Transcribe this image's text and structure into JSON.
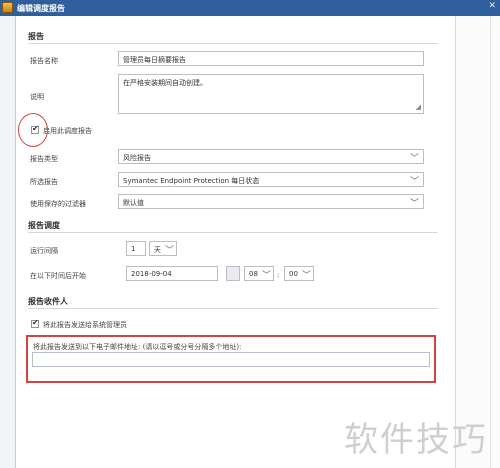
{
  "title": "编辑调度报告",
  "sections": {
    "report": "报告",
    "schedule": "报告调度",
    "recipients": "报告收件人"
  },
  "report": {
    "name_label": "报告名称",
    "name_value": "管理员每日摘要报告",
    "desc_label": "说明",
    "desc_value": "在严格安装期间自动创建。",
    "enable_label": "启用此调度报告",
    "enable_checked": true,
    "type_label": "报告类型",
    "type_value": "风险报告",
    "selected_label": "所选报告",
    "selected_value": "Symantec Endpoint Protection 每日状态",
    "filter_label": "使用保存的过滤器",
    "filter_value": "默认值"
  },
  "schedule": {
    "interval_label": "运行间隔",
    "interval_value": "1",
    "interval_unit": "天",
    "start_label": "在以下时间后开始",
    "date_value": "2018-09-04",
    "hour_value": "08",
    "colon": ":",
    "minute_value": "00"
  },
  "recipients": {
    "send_admin_label": "将此报告发送给系统管理员",
    "send_admin_checked": true,
    "email_label": "将此报告发送到以下电子邮件地址: (请以逗号或分号分隔多个地址):",
    "email_value": ""
  },
  "watermark": "软件技巧",
  "colors": {
    "titlebar": "#2e5e9c",
    "highlight": "#d24444"
  }
}
